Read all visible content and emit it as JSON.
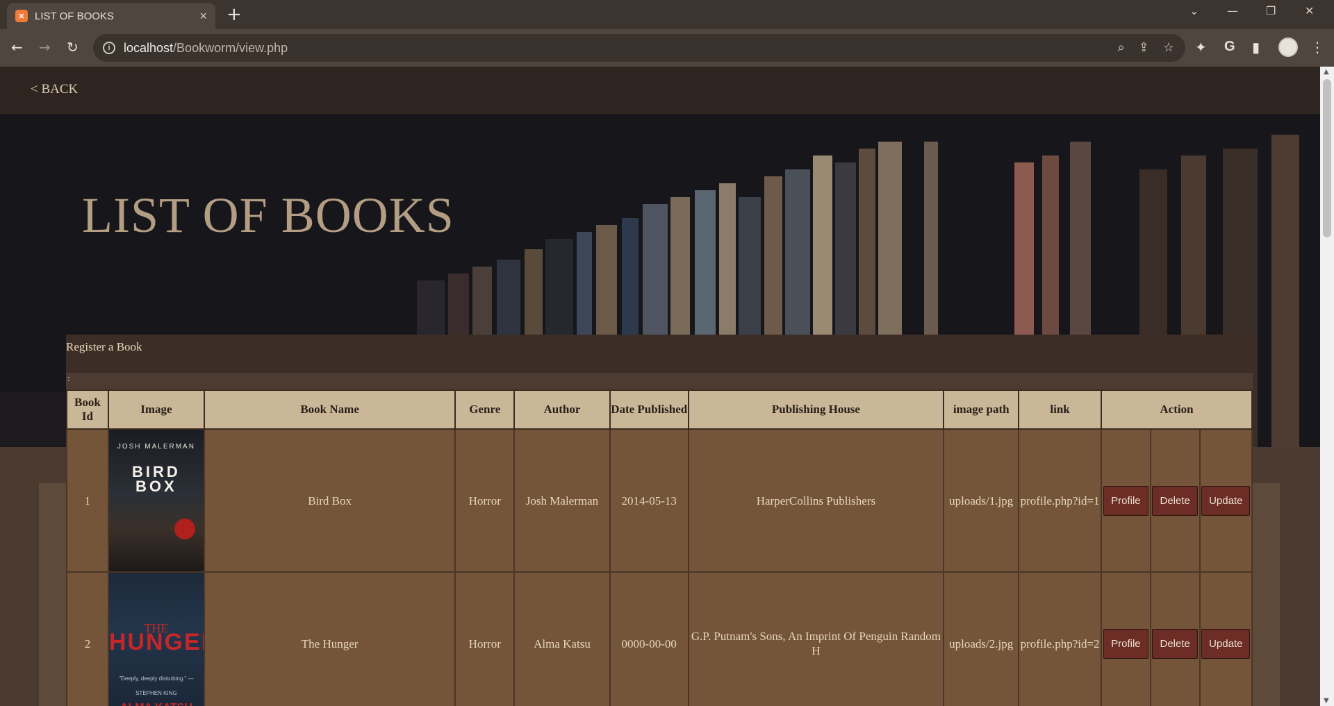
{
  "browser": {
    "tab_title": "LIST OF BOOKS",
    "url_host": "localhost",
    "url_path": "/Bookworm/view.php"
  },
  "nav": {
    "back_label": "< BACK"
  },
  "hero": {
    "title": "LIST OF BOOKS"
  },
  "panel": {
    "register_label": "Register a Book",
    "sub_text": ":"
  },
  "table": {
    "headers": [
      "Book Id",
      "Image",
      "Book Name",
      "Genre",
      "Author",
      "Date Published",
      "Publishing House",
      "image path",
      "link",
      "Action"
    ],
    "rows": [
      {
        "id": "1",
        "cover": {
          "author": "JOSH MALERMAN",
          "title": "BIRD BOX"
        },
        "name": "Bird Box",
        "genre": "Horror",
        "author": "Josh Malerman",
        "date": "2014-05-13",
        "publisher": "HarperCollins Publishers",
        "image_path": "uploads/1.jpg",
        "link": "profile.php?id=1"
      },
      {
        "id": "2",
        "cover": {
          "title_small": "THE",
          "title": "HUNGER",
          "quote": "\"Deeply, deeply disturbing.\" —STEPHEN KING",
          "author": "ALMA KATSU"
        },
        "name": "The Hunger",
        "genre": "Horror",
        "author": "Alma Katsu",
        "date": "0000-00-00",
        "publisher": "G.P. Putnam's Sons, An Imprint Of Penguin Random H",
        "image_path": "uploads/2.jpg",
        "link": "profile.php?id=2"
      }
    ],
    "actions": {
      "profile": "Profile",
      "delete": "Delete",
      "update": "Update"
    }
  },
  "colors": {
    "accent_button": "#6b2d26",
    "header_bg": "#c9b797",
    "row_bg": "#74553a"
  },
  "icons": [
    "xampp-favicon",
    "close-icon",
    "plus-icon",
    "back-arrow-icon",
    "forward-arrow-icon",
    "reload-icon",
    "info-icon",
    "zoom-icon",
    "share-icon",
    "star-icon",
    "extensions-icon",
    "google-icon",
    "sidepanel-icon",
    "avatar",
    "menu-icon"
  ]
}
